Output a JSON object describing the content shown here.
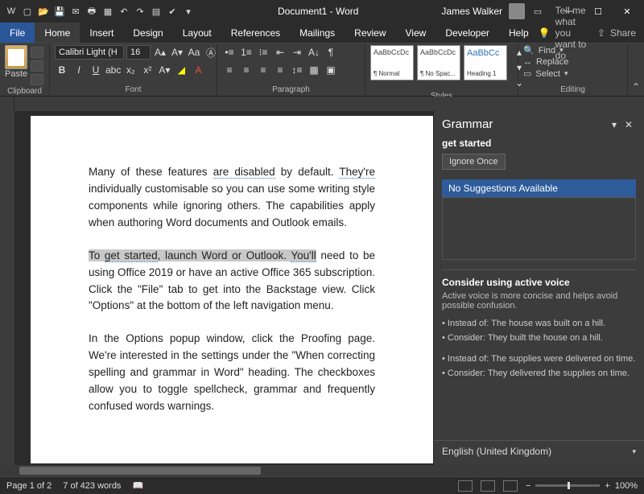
{
  "title": "Document1 - Word",
  "user": "James Walker",
  "tabs": [
    "File",
    "Home",
    "Insert",
    "Design",
    "Layout",
    "References",
    "Mailings",
    "Review",
    "View",
    "Developer",
    "Help"
  ],
  "active_tab": 1,
  "tell_me": "Tell me what you want to do",
  "share": "Share",
  "ribbon": {
    "clipboard": {
      "paste": "Paste",
      "label": "Clipboard"
    },
    "font": {
      "name": "Calibri Light (H",
      "size": "16",
      "label": "Font"
    },
    "paragraph": {
      "label": "Paragraph"
    },
    "styles": {
      "label": "Styles",
      "items": [
        {
          "preview": "AaBbCcDc",
          "name": "¶ Normal"
        },
        {
          "preview": "AaBbCcDc",
          "name": "¶ No Spac..."
        },
        {
          "preview": "AaBbCc",
          "name": "Heading 1"
        }
      ]
    },
    "editing": {
      "find": "Find",
      "replace": "Replace",
      "select": "Select",
      "label": "Editing"
    }
  },
  "doc": {
    "p1a": "Many of these features ",
    "p1b": "are disabled",
    "p1c": " by default. ",
    "p1d": "They're",
    "p1e": " individually customisable so you can use some writing style components while ignoring others. The capabilities apply when authoring Word documents and Outlook emails.",
    "p2a": "To ",
    "p2b": "get started",
    "p2c": ", launch Word or Outlook. ",
    "p2d": "You'll",
    "p2e": " need to be using Office 2019 or have an active Office 365 subscription. Click the \"File\" tab to get into the Backstage view. Click \"Options\" at the bottom of the left navigation menu.",
    "p3": "In the Options popup window, click the Proofing page. We're interested in the settings under the \"When correcting spelling and grammar in Word\" heading. The checkboxes allow you to toggle spellcheck, grammar and frequently confused words warnings."
  },
  "grammar": {
    "title": "Grammar",
    "term": "get started",
    "ignore": "Ignore Once",
    "nosuggest": "No Suggestions Available",
    "tip_title": "Consider using active voice",
    "tip_body": "Active voice is more concise and helps avoid possible confusion.",
    "ex1a": "• Instead of: The house was built on a hill.",
    "ex1b": "• Consider: They built the house on a hill.",
    "ex2a": "• Instead of: The supplies were delivered on time.",
    "ex2b": "• Consider: They delivered the supplies on time.",
    "lang": "English (United Kingdom)"
  },
  "status": {
    "page": "Page 1 of 2",
    "words": "7 of 423 words",
    "zoom": "100%"
  }
}
